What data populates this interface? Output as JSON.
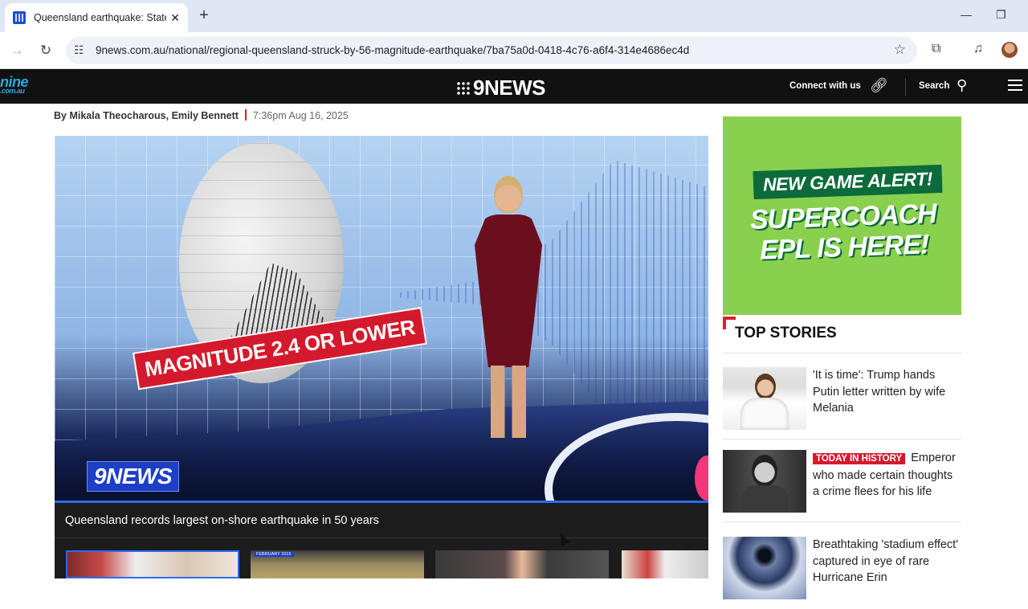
{
  "browser": {
    "tab_title": "Queensland earthquake: State a",
    "url": "9news.com.au/national/regional-queensland-struck-by-56-magnitude-earthquake/7ba75a0d-0418-4c76-a6f4-314e4686ec4d",
    "new_tab": "+",
    "close_tab": "✕",
    "minimize": "—",
    "restore": "❐"
  },
  "site": {
    "nine_logo": "nine",
    "nine_logo_sub": ".com.au",
    "brand": "9NEWS",
    "connect": "Connect with us",
    "search": "Search"
  },
  "article": {
    "byline": "By Mikala Theocharous, Emily Bennett",
    "timestamp": "7:36pm Aug 16, 2025",
    "video": {
      "banner": "MAGNITUDE 2.4 OR LOWER",
      "watermark": "9NEWS",
      "caption": "Queensland records largest on-shore earthquake in 50 years",
      "thumb_label": "FEBRUARY 2015"
    }
  },
  "sidebar": {
    "ad": {
      "pill": "NEW GAME ALERT!",
      "headline": "SUPERCOACH EPL IS HERE!",
      "bg_color": "#8ad04f"
    },
    "top_stories_title": "TOP STORIES",
    "stories": [
      {
        "tag": "",
        "title": "'It is time': Trump hands Putin letter written by wife Melania"
      },
      {
        "tag": "TODAY IN HISTORY",
        "title": "Emperor who made certain thoughts a crime flees for his life"
      },
      {
        "tag": "",
        "title": "Breathtaking 'stadium effect' captured in eye of rare Hurricane Erin"
      }
    ]
  }
}
